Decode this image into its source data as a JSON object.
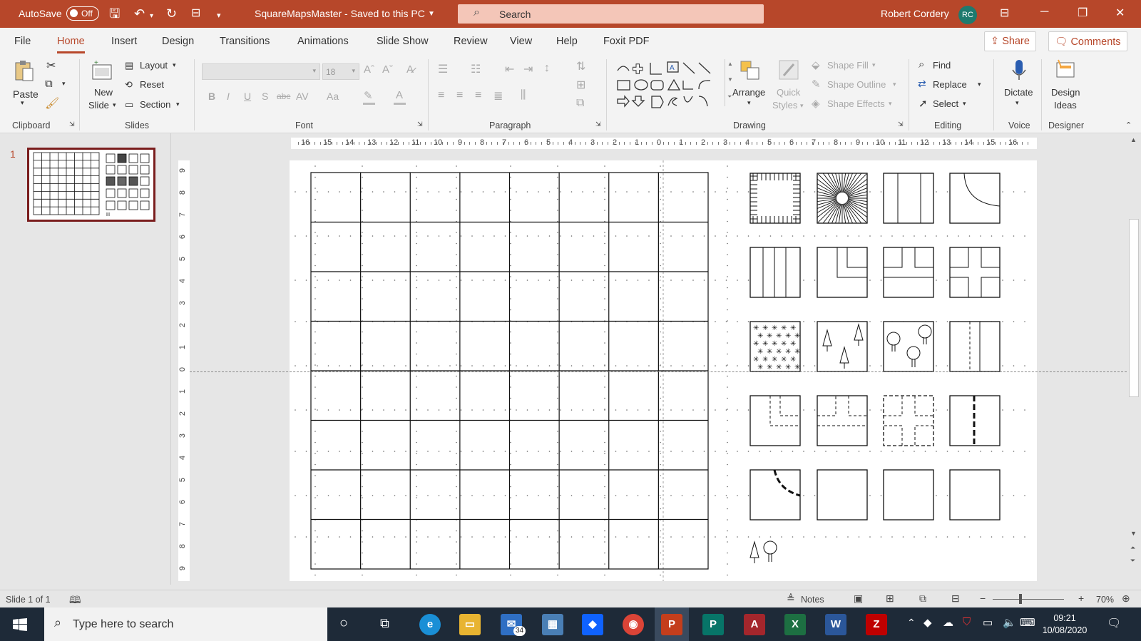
{
  "titlebar": {
    "autosave_label": "AutoSave",
    "autosave_state": "Off",
    "document_title": "SquareMapsMaster - Saved to this PC",
    "search_placeholder": "Search",
    "user_name": "Robert Cordery",
    "user_initials": "RC",
    "accent_color": "#b7472a"
  },
  "menu": {
    "tabs": [
      "File",
      "Home",
      "Insert",
      "Design",
      "Transitions",
      "Animations",
      "Slide Show",
      "Review",
      "View",
      "Help",
      "Foxit PDF"
    ],
    "active_tab": "Home",
    "share_label": "Share",
    "comments_label": "Comments"
  },
  "ribbon": {
    "clipboard": {
      "group": "Clipboard",
      "paste": "Paste"
    },
    "slides": {
      "group": "Slides",
      "new_slide_line1": "New",
      "new_slide_line2": "Slide",
      "layout": "Layout",
      "reset": "Reset",
      "section": "Section"
    },
    "font": {
      "group": "Font",
      "size": "18",
      "bold": "B",
      "italic": "I",
      "underline": "U",
      "shadow": "S",
      "strike": "abc",
      "spacing": "AV",
      "case": "Aa",
      "grow": "Aˆ",
      "shrink": "Aˇ"
    },
    "paragraph": {
      "group": "Paragraph"
    },
    "drawing": {
      "group": "Drawing",
      "arrange": "Arrange",
      "quick_styles_line1": "Quick",
      "quick_styles_line2": "Styles",
      "shape_fill": "Shape Fill",
      "shape_outline": "Shape Outline",
      "shape_effects": "Shape Effects"
    },
    "editing": {
      "group": "Editing",
      "find": "Find",
      "replace": "Replace",
      "select": "Select"
    },
    "voice": {
      "group": "Voice",
      "dictate": "Dictate"
    },
    "designer": {
      "group": "Designer",
      "design_ideas_line1": "Design",
      "design_ideas_line2": "Ideas"
    }
  },
  "slides_pane": {
    "slide_number": "1"
  },
  "rulers": {
    "horizontal": [
      "16",
      "15",
      "14",
      "13",
      "12",
      "11",
      "10",
      "9",
      "8",
      "7",
      "6",
      "5",
      "4",
      "3",
      "2",
      "1",
      "0",
      "1",
      "2",
      "3",
      "4",
      "5",
      "6",
      "7",
      "8",
      "9",
      "10",
      "11",
      "12",
      "13",
      "14",
      "15",
      "16"
    ],
    "vertical": [
      "9",
      "8",
      "7",
      "6",
      "5",
      "4",
      "3",
      "2",
      "1",
      "0",
      "1",
      "2",
      "3",
      "4",
      "5",
      "6",
      "7",
      "8",
      "9"
    ]
  },
  "status": {
    "slide_info": "Slide 1 of 1",
    "notes": "Notes",
    "zoom": "70%",
    "zoom_minus": "−",
    "zoom_plus": "+"
  },
  "taskbar": {
    "search_placeholder": "Type here to search",
    "mail_badge": "34",
    "time": "09:21",
    "date": "10/08/2020"
  }
}
